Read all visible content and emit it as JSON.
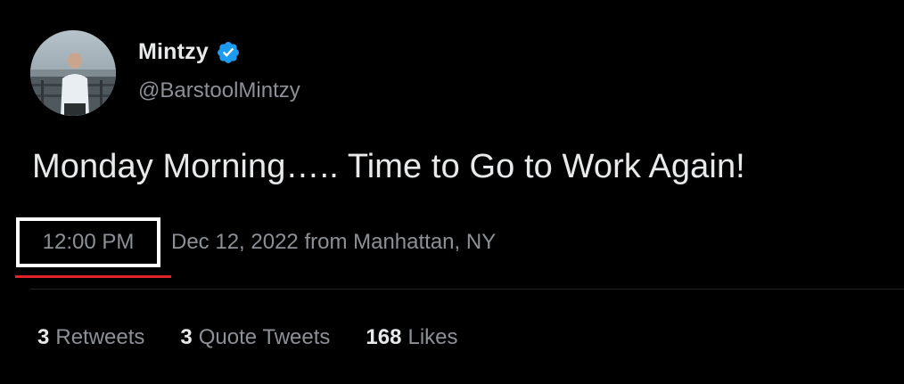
{
  "author": {
    "display_name": "Mintzy",
    "handle": "@BarstoolMintzy",
    "verified_icon": "verified-badge-icon",
    "verified_color": "#1d9bf0"
  },
  "tweet": {
    "text": "Monday Morning….. Time to Go to Work Again!",
    "time": "12:00 PM",
    "date_location": "Dec 12, 2022 from Manhattan, NY"
  },
  "stats": [
    {
      "count": "3",
      "label": "Retweets"
    },
    {
      "count": "3",
      "label": "Quote Tweets"
    },
    {
      "count": "168",
      "label": "Likes"
    }
  ],
  "highlight": {
    "box_color": "#ffffff",
    "underline_color": "#e0222b"
  }
}
